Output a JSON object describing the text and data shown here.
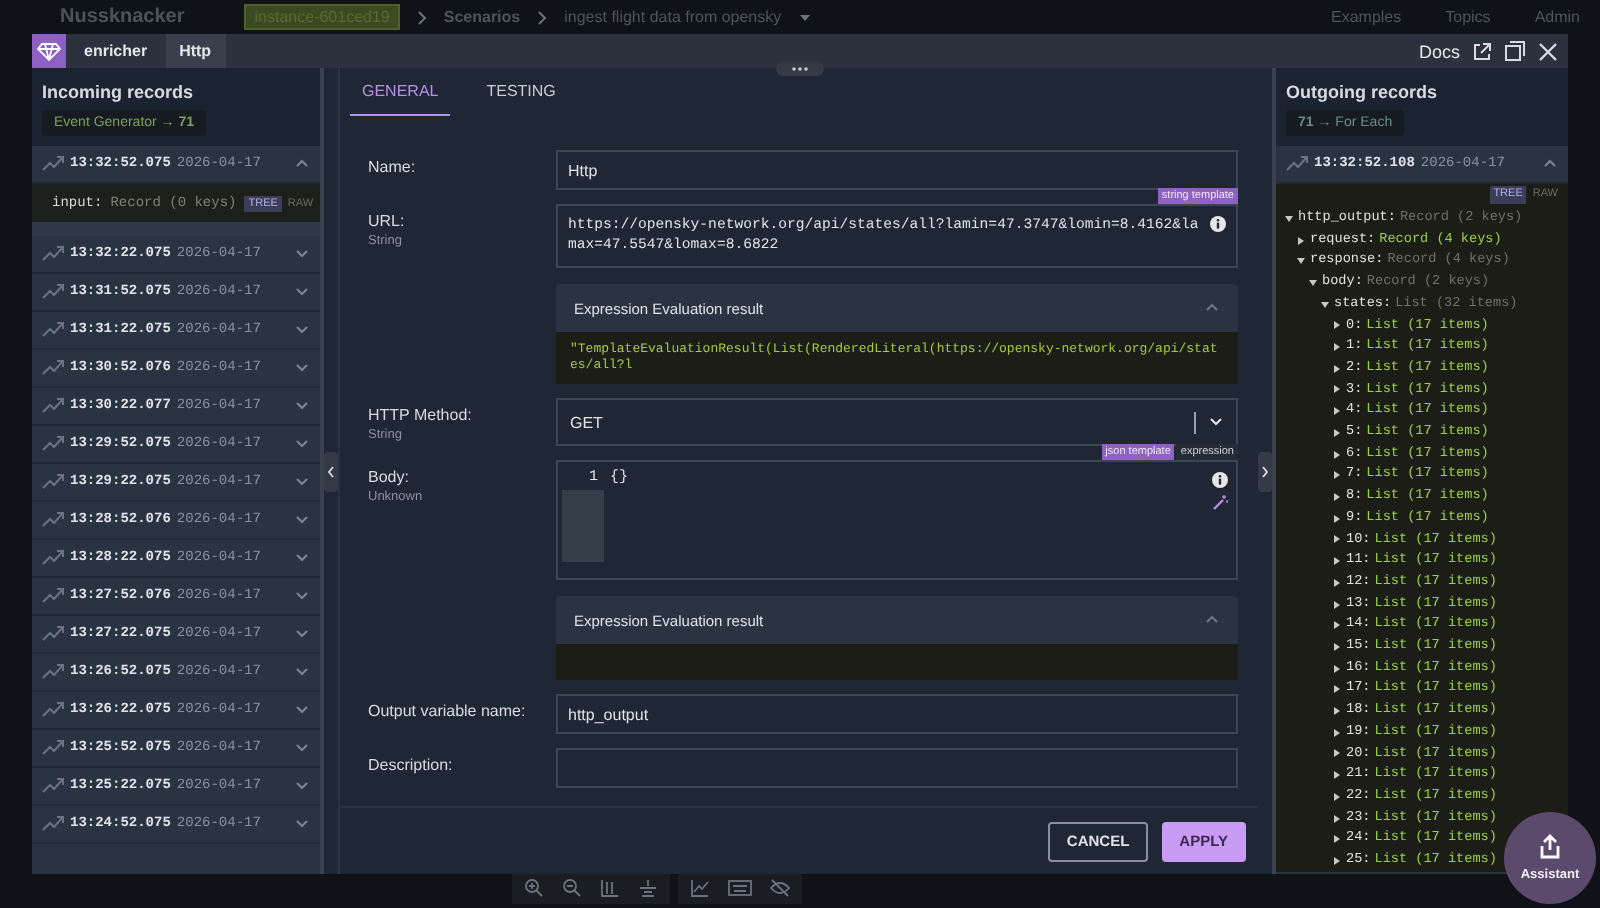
{
  "app_bar": {
    "logo": "Nussknacker",
    "breadcrumbs": [
      {
        "text": "instance-601ced19",
        "kind": "badge"
      },
      {
        "text": "Scenarios",
        "kind": "link"
      },
      {
        "text": "ingest flight data from opensky",
        "kind": "current"
      }
    ],
    "nav": [
      "Examples",
      "Topics",
      "Admin"
    ]
  },
  "modal": {
    "header": {
      "node_type": "enricher",
      "node_name": "Http",
      "docs": "Docs"
    },
    "incoming": {
      "title": "Incoming records",
      "badge": "Event Generator → **71**",
      "records": [
        {
          "time": "13:32:52.075",
          "date": "2026-04-17",
          "expanded": true,
          "detail": {
            "key": "input:",
            "value": "Record (0 keys)"
          },
          "views": [
            {
              "label": "TREE",
              "selected": true
            },
            {
              "label": "RAW",
              "selected": false
            }
          ]
        },
        {
          "time": "13:32:22.075",
          "date": "2026-04-17",
          "expanded": false
        },
        {
          "time": "13:31:52.075",
          "date": "2026-04-17",
          "expanded": false
        },
        {
          "time": "13:31:22.075",
          "date": "2026-04-17",
          "expanded": false
        },
        {
          "time": "13:30:52.076",
          "date": "2026-04-17",
          "expanded": false
        },
        {
          "time": "13:30:22.077",
          "date": "2026-04-17",
          "expanded": false
        },
        {
          "time": "13:29:52.075",
          "date": "2026-04-17",
          "expanded": false
        },
        {
          "time": "13:29:22.075",
          "date": "2026-04-17",
          "expanded": false
        },
        {
          "time": "13:28:52.076",
          "date": "2026-04-17",
          "expanded": false
        },
        {
          "time": "13:28:22.075",
          "date": "2026-04-17",
          "expanded": false
        },
        {
          "time": "13:27:52.076",
          "date": "2026-04-17",
          "expanded": false
        },
        {
          "time": "13:27:22.075",
          "date": "2026-04-17",
          "expanded": false
        },
        {
          "time": "13:26:52.075",
          "date": "2026-04-17",
          "expanded": false
        },
        {
          "time": "13:26:22.075",
          "date": "2026-04-17",
          "expanded": false
        },
        {
          "time": "13:25:52.075",
          "date": "2026-04-17",
          "expanded": false
        },
        {
          "time": "13:25:22.075",
          "date": "2026-04-17",
          "expanded": false
        },
        {
          "time": "13:24:52.075",
          "date": "2026-04-17",
          "expanded": false
        }
      ]
    },
    "tabs": [
      {
        "label": "GENERAL",
        "selected": true
      },
      {
        "label": "TESTING",
        "selected": false
      }
    ],
    "fields": [
      {
        "kind": "input",
        "label": "Name:",
        "value": "Http"
      },
      {
        "kind": "template",
        "label": "URL:",
        "type": "String",
        "badge": "string template",
        "value": "https://opensky-network.org/api/states/all?lamin=47.3747&lomin=8.4162&lamax=47.5547&lomax=8.6822",
        "result": {
          "title": "Expression Evaluation result",
          "expanded": true,
          "text": "\"TemplateEvaluationResult(List(RenderedLiteral(https://opensky-network.org/api/states/all?l"
        }
      },
      {
        "kind": "select",
        "label": "HTTP Method:",
        "type": "String",
        "value": "GET"
      },
      {
        "kind": "code",
        "label": "Body:",
        "type": "Unknown",
        "modes": [
          {
            "label": "json template",
            "selected": true
          },
          {
            "label": "expression",
            "selected": false
          }
        ],
        "lines": [
          {
            "number": "1",
            "text": "{}"
          }
        ],
        "result": {
          "title": "Expression Evaluation result",
          "expanded": true
        }
      },
      {
        "kind": "input",
        "label": "Output variable name:",
        "value": "http_output"
      },
      {
        "kind": "input",
        "label": "Description:"
      }
    ],
    "buttons": [
      {
        "label": "CANCEL",
        "kind": "secondary"
      },
      {
        "label": "APPLY",
        "kind": "primary"
      }
    ],
    "outgoing": {
      "title": "Outgoing records",
      "badge": "**71** → For Each",
      "records": [
        {
          "time": "13:32:52.108",
          "date": "2026-04-17",
          "expanded": true,
          "views": [
            {
              "label": "TREE",
              "selected": true
            },
            {
              "label": "RAW",
              "selected": false
            }
          ],
          "tree": [
            {
              "key": "http_output:",
              "value": "Record (2 keys)",
              "expanded": true,
              "children": [
                {
                  "key": "request:",
                  "value": "Record (4 keys)",
                  "expanded": false
                },
                {
                  "key": "response:",
                  "value": "Record (4 keys)",
                  "expanded": true,
                  "children": [
                    {
                      "key": "body:",
                      "value": "Record (2 keys)",
                      "expanded": true,
                      "children": [
                        {
                          "key": "states:",
                          "value": "List (32 items)",
                          "expanded": true,
                          "children": [
                            {
                              "key": "0:",
                              "value": "List (17 items)",
                              "expanded": false
                            },
                            {
                              "key": "1:",
                              "value": "List (17 items)",
                              "expanded": false
                            },
                            {
                              "key": "2:",
                              "value": "List (17 items)",
                              "expanded": false
                            },
                            {
                              "key": "3:",
                              "value": "List (17 items)",
                              "expanded": false
                            },
                            {
                              "key": "4:",
                              "value": "List (17 items)",
                              "expanded": false
                            },
                            {
                              "key": "5:",
                              "value": "List (17 items)",
                              "expanded": false
                            },
                            {
                              "key": "6:",
                              "value": "List (17 items)",
                              "expanded": false
                            },
                            {
                              "key": "7:",
                              "value": "List (17 items)",
                              "expanded": false
                            },
                            {
                              "key": "8:",
                              "value": "List (17 items)",
                              "expanded": false
                            },
                            {
                              "key": "9:",
                              "value": "List (17 items)",
                              "expanded": false
                            },
                            {
                              "key": "10:",
                              "value": "List (17 items)",
                              "expanded": false
                            },
                            {
                              "key": "11:",
                              "value": "List (17 items)",
                              "expanded": false
                            },
                            {
                              "key": "12:",
                              "value": "List (17 items)",
                              "expanded": false
                            },
                            {
                              "key": "13:",
                              "value": "List (17 items)",
                              "expanded": false
                            },
                            {
                              "key": "14:",
                              "value": "List (17 items)",
                              "expanded": false
                            },
                            {
                              "key": "15:",
                              "value": "List (17 items)",
                              "expanded": false
                            },
                            {
                              "key": "16:",
                              "value": "List (17 items)",
                              "expanded": false
                            },
                            {
                              "key": "17:",
                              "value": "List (17 items)",
                              "expanded": false
                            },
                            {
                              "key": "18:",
                              "value": "List (17 items)",
                              "expanded": false
                            },
                            {
                              "key": "19:",
                              "value": "List (17 items)",
                              "expanded": false
                            },
                            {
                              "key": "20:",
                              "value": "List (17 items)",
                              "expanded": false
                            },
                            {
                              "key": "21:",
                              "value": "List (17 items)",
                              "expanded": false
                            },
                            {
                              "key": "22:",
                              "value": "List (17 items)",
                              "expanded": false
                            },
                            {
                              "key": "23:",
                              "value": "List (17 items)",
                              "expanded": false
                            },
                            {
                              "key": "24:",
                              "value": "List (17 items)",
                              "expanded": false
                            },
                            {
                              "key": "25:",
                              "value": "List (17 items)",
                              "expanded": false
                            }
                          ]
                        }
                      ]
                    }
                  ]
                }
              ]
            }
          ]
        }
      ]
    }
  },
  "assistant": {
    "label": "Assistant"
  }
}
